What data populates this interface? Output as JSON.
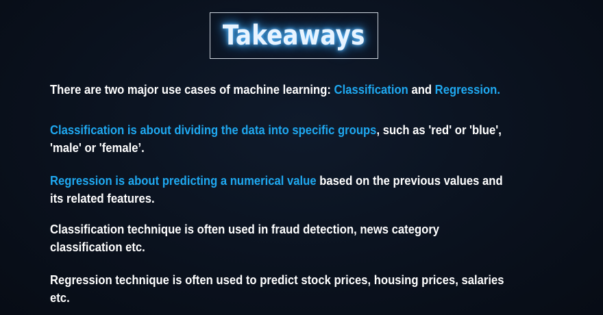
{
  "title": "Takeaways",
  "paragraphs": {
    "p1": {
      "text1": "There are two major use cases of machine learning: ",
      "hl1": "Classification",
      "text2": " and ",
      "hl2": "Regression."
    },
    "p2": {
      "hl": "Classification is about dividing the data into specific groups",
      "text": ", such as 'red' or 'blue',",
      "line2": "'male' or 'female’."
    },
    "p3": {
      "hl": "Regression is about predicting a numerical value",
      "text": " based on the previous values and",
      "line2": "its related features."
    },
    "p4": {
      "line1": "Classification technique is often used in fraud detection, news category",
      "line2": "classification etc."
    },
    "p5": {
      "line1": "Regression technique is often used to predict stock prices, housing prices, salaries etc."
    }
  },
  "colors": {
    "background": "#0b1220",
    "highlight": "#1fa8f0",
    "text": "#ffffff",
    "title_glow": "#3a9ee8"
  }
}
